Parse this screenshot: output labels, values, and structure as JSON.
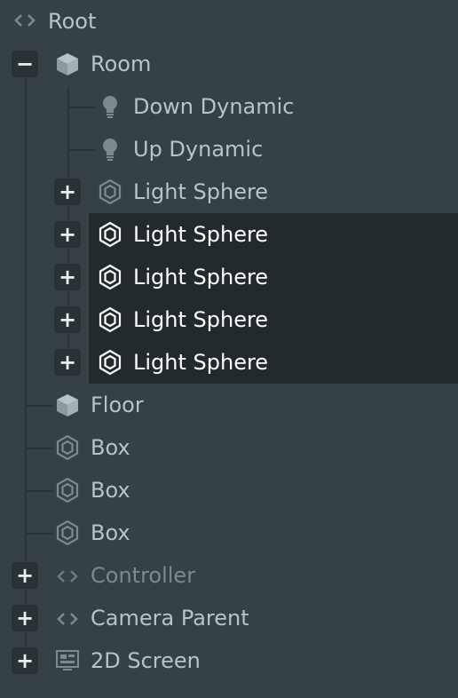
{
  "tree": {
    "root": {
      "label": "Root",
      "icon": "code-brackets-icon"
    },
    "room": {
      "label": "Room",
      "icon": "cube-icon",
      "toggle": "−"
    },
    "down_dynamic": {
      "label": "Down Dynamic",
      "icon": "light-bulb-icon"
    },
    "up_dynamic": {
      "label": "Up Dynamic",
      "icon": "light-bulb-icon"
    },
    "light_sphere_1": {
      "label": "Light Sphere",
      "icon": "hexagon-icon",
      "toggle": "+"
    },
    "light_sphere_2": {
      "label": "Light Sphere",
      "icon": "hexagon-icon",
      "toggle": "+",
      "selected": true
    },
    "light_sphere_3": {
      "label": "Light Sphere",
      "icon": "hexagon-icon",
      "toggle": "+",
      "selected": true
    },
    "light_sphere_4": {
      "label": "Light Sphere",
      "icon": "hexagon-icon",
      "toggle": "+",
      "selected": true
    },
    "light_sphere_5": {
      "label": "Light Sphere",
      "icon": "hexagon-icon",
      "toggle": "+",
      "selected": true
    },
    "floor": {
      "label": "Floor",
      "icon": "cube-icon"
    },
    "box_1": {
      "label": "Box",
      "icon": "hexagon-icon"
    },
    "box_2": {
      "label": "Box",
      "icon": "hexagon-icon"
    },
    "box_3": {
      "label": "Box",
      "icon": "hexagon-icon"
    },
    "controller": {
      "label": "Controller",
      "icon": "code-brackets-icon",
      "toggle": "+",
      "disabled": true
    },
    "camera_parent": {
      "label": "Camera Parent",
      "icon": "code-brackets-icon",
      "toggle": "+"
    },
    "screen_2d": {
      "label": "2D Screen",
      "icon": "screen-icon",
      "toggle": "+"
    }
  },
  "colors": {
    "background": "#364145",
    "selected_background": "#232a2c",
    "text": "#b7c3c7",
    "selected_text": "#ffffff",
    "disabled_text": "#7d898d"
  }
}
